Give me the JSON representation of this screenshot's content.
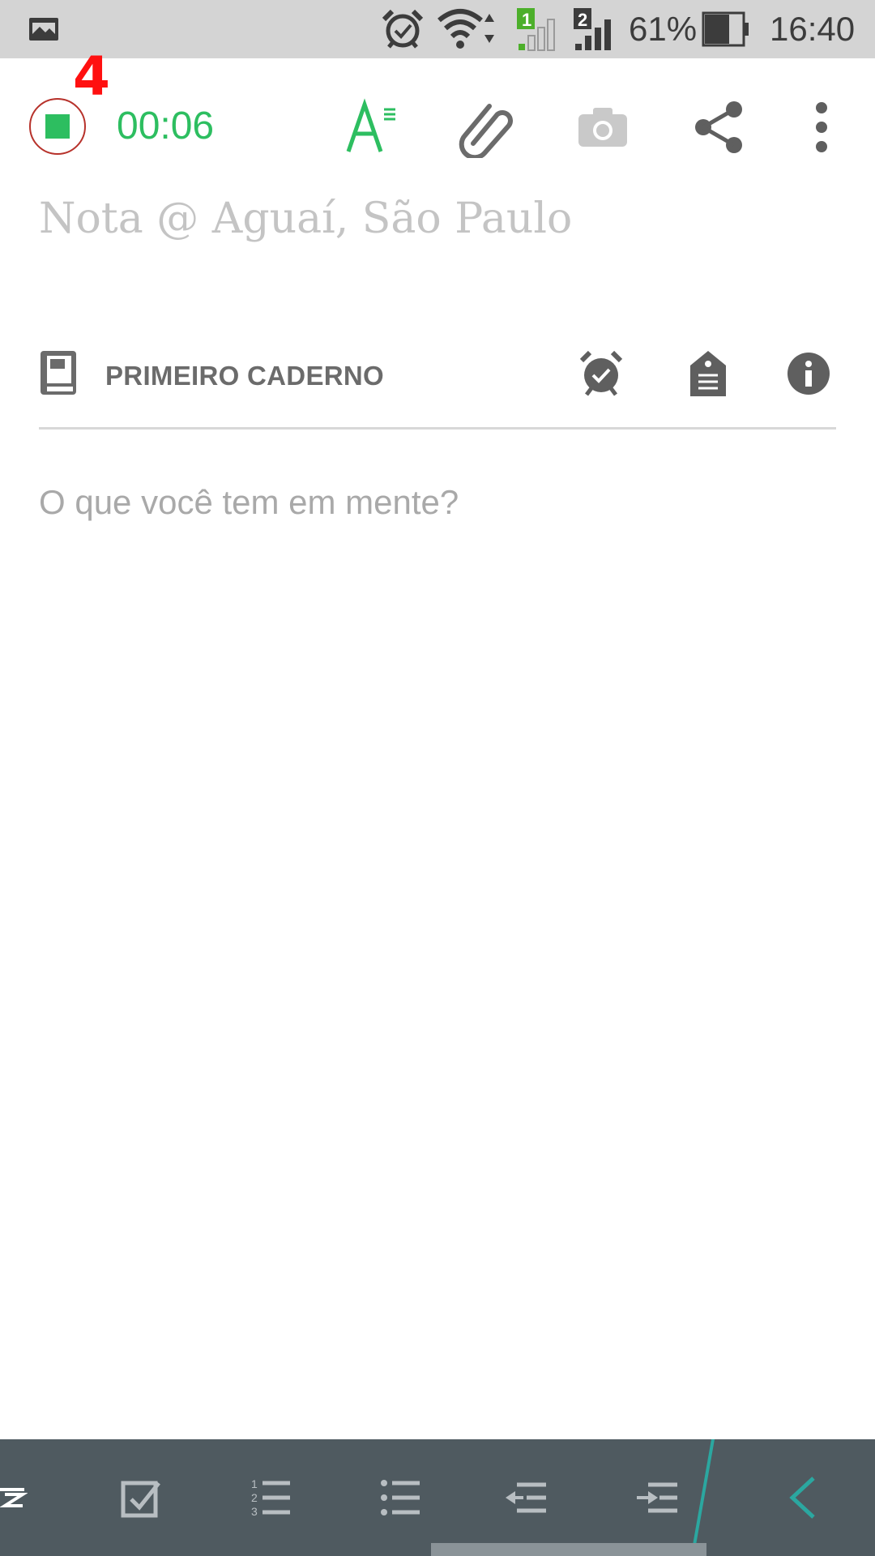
{
  "status_bar": {
    "sim1_label": "1",
    "sim2_label": "2",
    "battery_percent": "61%",
    "time": "16:40",
    "icons": [
      "gallery-icon",
      "alarm-icon",
      "wifi-icon",
      "signal-sim1-icon",
      "signal-sim2-icon",
      "battery-icon"
    ]
  },
  "toolbar": {
    "record_badge": "4",
    "timer": "00:06",
    "icons": [
      "stop-record-icon",
      "text-format-icon",
      "attach-icon",
      "camera-icon",
      "share-icon",
      "more-vert-icon"
    ]
  },
  "note": {
    "title_placeholder": "Nota @ Aguaí, São Paulo",
    "body_placeholder": "O que você tem em mente?"
  },
  "notebook": {
    "name": "PRIMEIRO CADERNO",
    "icons": [
      "notebook-icon",
      "reminder-icon",
      "tag-icon",
      "info-icon"
    ]
  },
  "format_bar": {
    "icons": [
      "text-format-partial-icon",
      "checkbox-icon",
      "numbered-list-icon",
      "bulleted-list-icon",
      "outdent-icon",
      "indent-icon",
      "collapse-icon"
    ],
    "accent": "#2ba7a0"
  },
  "colors": {
    "brand_green": "#2dbe60",
    "record_ring": "#b7322b",
    "badge_red": "#ff1010"
  }
}
